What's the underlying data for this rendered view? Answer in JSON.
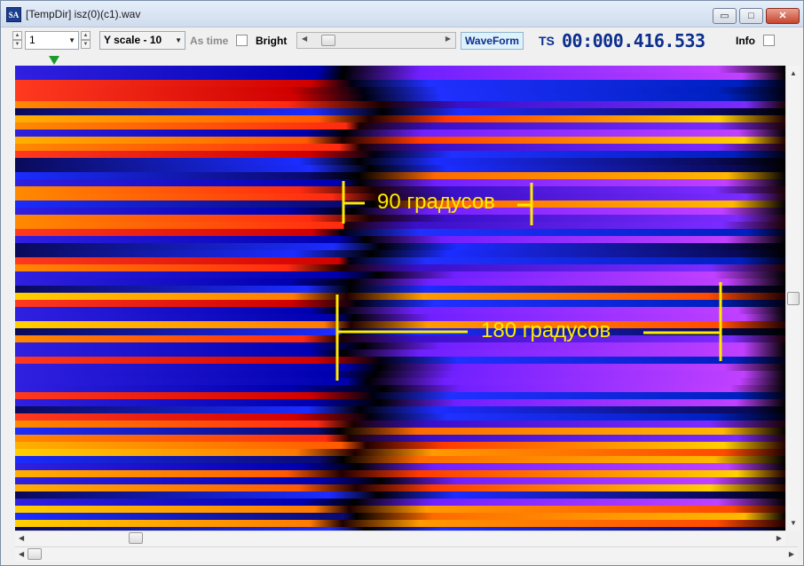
{
  "window": {
    "title": "[TempDir] isz(0)(c1).wav",
    "app_icon_text": "SA",
    "minimize_glyph": "▭",
    "maximize_glyph": "□",
    "close_glyph": "✕"
  },
  "toolbar": {
    "channel_value": "1",
    "yscale_value": "Y scale - 10",
    "as_time_label": "As time",
    "as_time_checked": false,
    "bright_label": "Bright",
    "bright_checked": false,
    "waveform_label": "WaveForm",
    "ts_label": "TS",
    "timestamp": "00:000.416.533",
    "info_label": "Info",
    "info_checked": false
  },
  "annotations": {
    "label_90": "90 градусов",
    "label_180": "180 градусов",
    "color": "#ffea00"
  },
  "colors": {
    "accent": "#0c2f8e",
    "marker": "#1e9a2a",
    "waveform_bg": "#dff1fb"
  },
  "icons": {
    "spin_up": "▲",
    "spin_down": "▼",
    "dropdown": "▼",
    "left": "◀",
    "right": "▶"
  }
}
